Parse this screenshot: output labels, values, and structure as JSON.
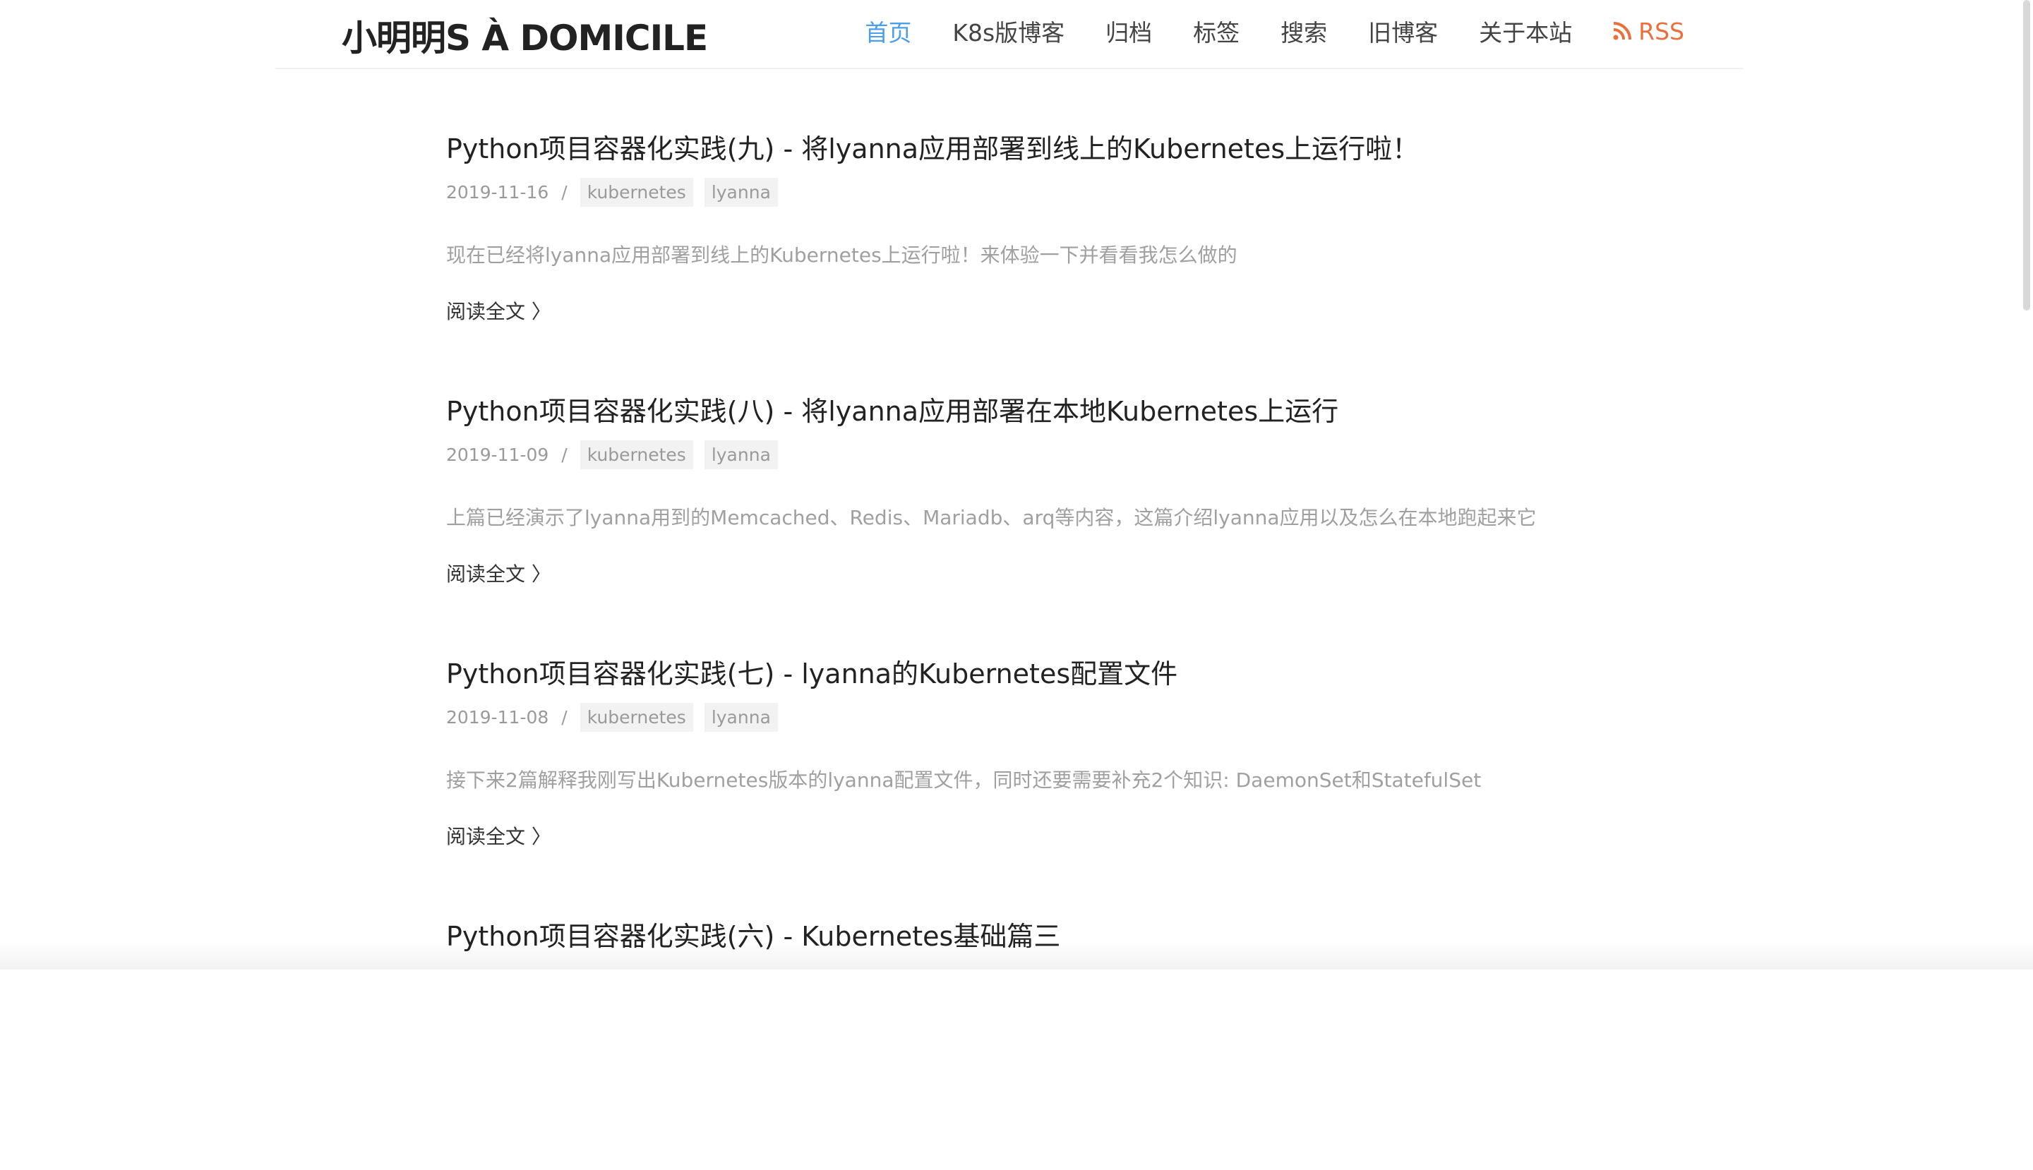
{
  "header": {
    "site_title": "小明明S À DOMICILE",
    "nav": [
      {
        "label": "首页"
      },
      {
        "label": "K8s版博客"
      },
      {
        "label": "归档"
      },
      {
        "label": "标签"
      },
      {
        "label": "搜索"
      },
      {
        "label": "旧博客"
      },
      {
        "label": "关于本站"
      }
    ],
    "rss_label": "RSS",
    "active_color": "#4a9eeb",
    "rss_color": "#eb6f3a"
  },
  "posts": [
    {
      "title": "Python项目容器化实践(九) - 将lyanna应用部署到线上的Kubernetes上运行啦！",
      "date": "2019-11-16",
      "sep": "/",
      "tags": [
        "kubernetes",
        "lyanna"
      ],
      "summary": "现在已经将lyanna应用部署到线上的Kubernetes上运行啦！来体验一下并看看我怎么做的",
      "read_more": "阅读全文 〉"
    },
    {
      "title": "Python项目容器化实践(八) - 将lyanna应用部署在本地Kubernetes上运行",
      "date": "2019-11-09",
      "sep": "/",
      "tags": [
        "kubernetes",
        "lyanna"
      ],
      "summary": "上篇已经演示了lyanna用到的Memcached、Redis、Mariadb、arq等内容，这篇介绍lyanna应用以及怎么在本地跑起来它",
      "read_more": "阅读全文 〉"
    },
    {
      "title": "Python项目容器化实践(七) - lyanna的Kubernetes配置文件",
      "date": "2019-11-08",
      "sep": "/",
      "tags": [
        "kubernetes",
        "lyanna"
      ],
      "summary": "接下来2篇解释我刚写出Kubernetes版本的lyanna配置文件，同时还要需要补充2个知识: DaemonSet和StatefulSet",
      "read_more": "阅读全文 〉"
    },
    {
      "title": "Python项目容器化实践(六) - Kubernetes基础篇三"
    }
  ]
}
